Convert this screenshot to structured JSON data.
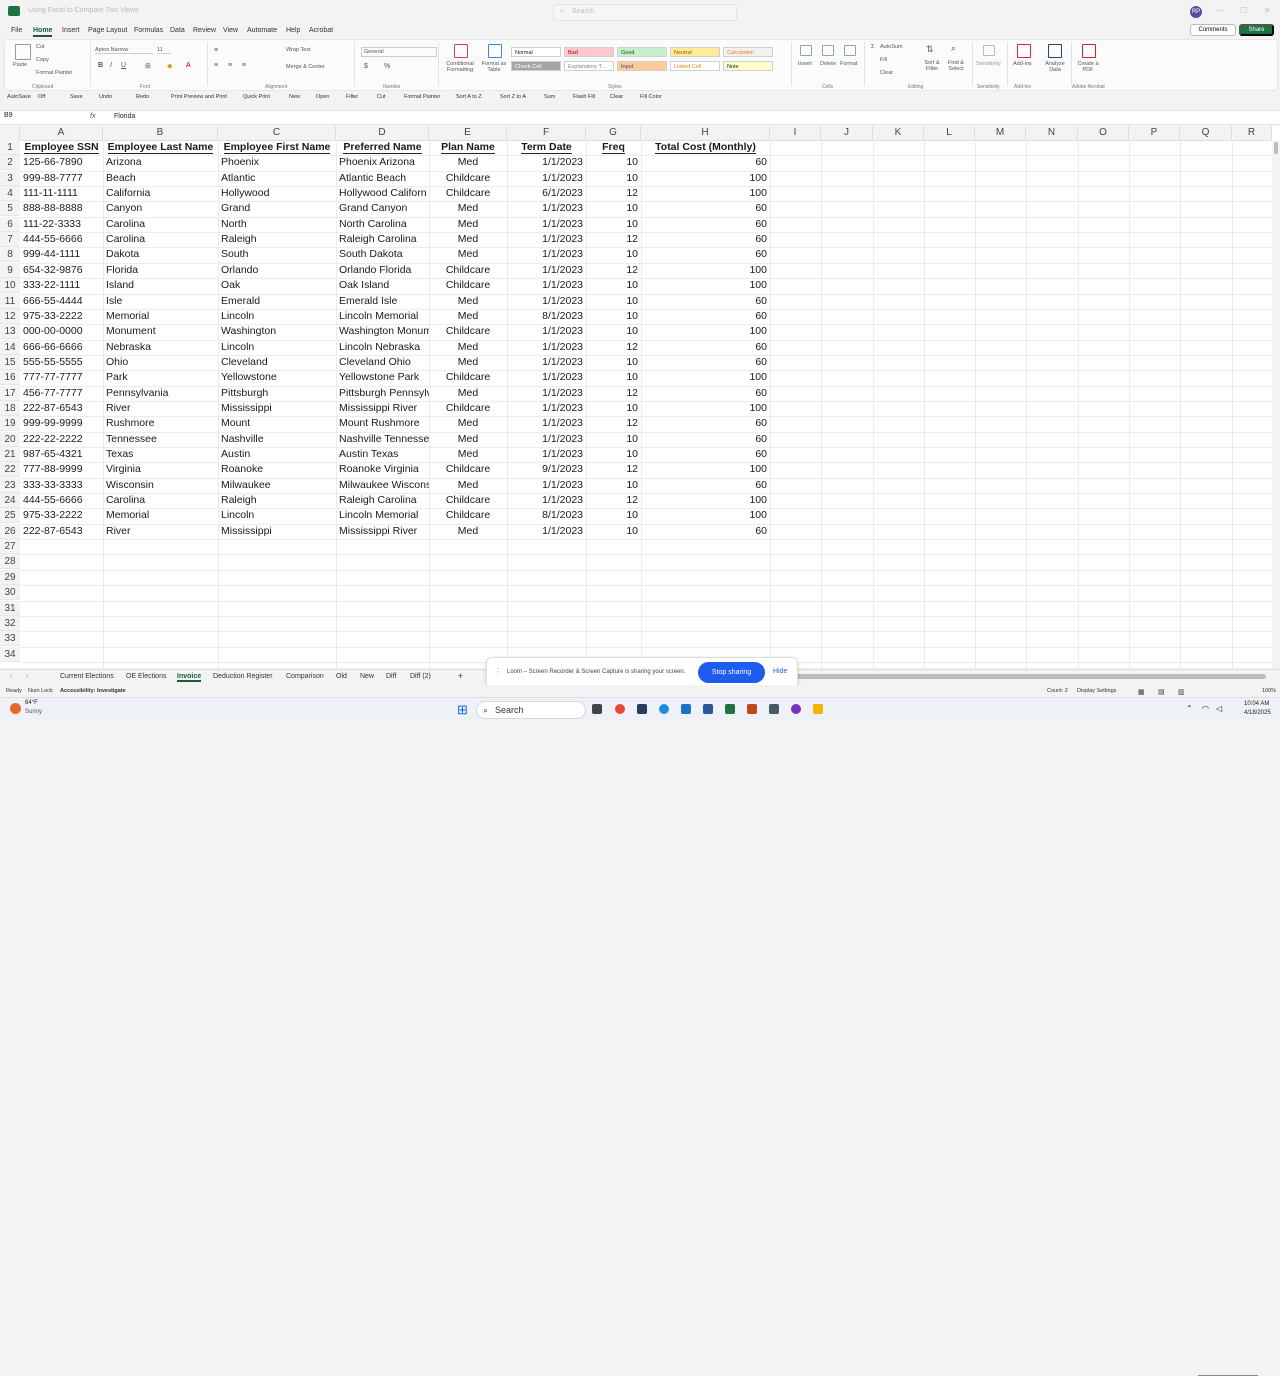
{
  "window": {
    "title": "Using Excel to Compare Two Views",
    "search_placeholder": "Search",
    "avatar_initials": "RP"
  },
  "menu": {
    "items": [
      "File",
      "Home",
      "Insert",
      "Page Layout",
      "Formulas",
      "Data",
      "Review",
      "View",
      "Automate",
      "Help",
      "Acrobat"
    ],
    "active": "Home",
    "comments": "Comments",
    "share": "Share"
  },
  "ribbon": {
    "clipboard": {
      "paste": "Paste",
      "cut": "Cut",
      "copy": "Copy",
      "format_painter": "Format Painter",
      "group": "Clipboard"
    },
    "font": {
      "name": "Aptos Narrow",
      "size": "11",
      "group": "Font"
    },
    "alignment": {
      "wrap": "Wrap Text",
      "merge": "Merge & Center",
      "group": "Alignment"
    },
    "number": {
      "format": "General",
      "group": "Number"
    },
    "styles": {
      "conditional": "Conditional Formatting",
      "format_table": "Format as Table",
      "group": "Styles",
      "boxes": [
        {
          "label": "Normal",
          "bg": "#ffffff",
          "fg": "#222222"
        },
        {
          "label": "Bad",
          "bg": "#ffc7ce",
          "fg": "#9c0006"
        },
        {
          "label": "Good",
          "bg": "#c6efce",
          "fg": "#006100"
        },
        {
          "label": "Neutral",
          "bg": "#ffeb9c",
          "fg": "#9c5700"
        },
        {
          "label": "Calculation",
          "bg": "#f2f2f2",
          "fg": "#fa7d00"
        },
        {
          "label": "Check Cell",
          "bg": "#a5a5a5",
          "fg": "#ffffff"
        },
        {
          "label": "Explanatory T...",
          "bg": "#ffffff",
          "fg": "#7f7f7f"
        },
        {
          "label": "Input",
          "bg": "#ffcc99",
          "fg": "#3f3f76"
        },
        {
          "label": "Linked Cell",
          "bg": "#ffffff",
          "fg": "#fa7d00"
        },
        {
          "label": "Note",
          "bg": "#ffffcc",
          "fg": "#222222"
        }
      ]
    },
    "cells": {
      "insert": "Insert",
      "delete": "Delete",
      "format": "Format",
      "group": "Cells"
    },
    "editing": {
      "autosum": "AutoSum",
      "fill": "Fill",
      "clear": "Clear",
      "sort": "Sort & Filter",
      "find": "Find & Select",
      "group": "Editing"
    },
    "sensitivity": {
      "label": "Sensitivity",
      "group": "Sensitivity"
    },
    "addins": {
      "addins": "Add-ins",
      "analyze": "Analyze Data",
      "group": "Add-ins"
    },
    "acrobat": {
      "create_pdf": "Create a PDF",
      "group": "Adobe Acrobat"
    }
  },
  "qat": [
    "AutoSave",
    "Off",
    "Save",
    "Undo",
    "Redo",
    "Print Preview and Print",
    "Quick Print",
    "New",
    "Open",
    "Filter",
    "Cut",
    "Format Painter",
    "Sort A to Z",
    "Sort Z to A",
    "Sum",
    "Flash Fill",
    "Clear",
    "Fill Color"
  ],
  "formula_bar": {
    "name_box": "B9",
    "fx": "fx",
    "value": "Florida"
  },
  "columns": [
    "A",
    "B",
    "C",
    "D",
    "E",
    "F",
    "G",
    "H",
    "I",
    "J",
    "K",
    "L",
    "M",
    "N",
    "O",
    "P",
    "Q",
    "R"
  ],
  "row_numbers": [
    "1",
    "2",
    "3",
    "4",
    "5",
    "6",
    "7",
    "8",
    "9",
    "10",
    "11",
    "12",
    "13",
    "14",
    "15",
    "16",
    "17",
    "18",
    "19",
    "20",
    "21",
    "22",
    "23",
    "24",
    "25",
    "26",
    "27",
    "28",
    "29",
    "30",
    "31",
    "32",
    "33",
    "34"
  ],
  "headers": [
    "Employee SSN",
    "Employee Last Name",
    "Employee First Name",
    "Preferred Name",
    "Plan Name",
    "Term Date",
    "Freq",
    "Total Cost (Monthly)"
  ],
  "rows": [
    [
      "125-66-7890",
      "Arizona",
      "Phoenix",
      "Phoenix Arizona",
      "Med",
      "1/1/2023",
      "10",
      "60"
    ],
    [
      "999-88-7777",
      "Beach",
      "Atlantic",
      "Atlantic Beach",
      "Childcare",
      "1/1/2023",
      "10",
      "100"
    ],
    [
      "111-11-1111",
      "California",
      "Hollywood",
      "Hollywood Californ",
      "Childcare",
      "6/1/2023",
      "12",
      "100"
    ],
    [
      "888-88-8888",
      "Canyon",
      "Grand",
      "Grand Canyon",
      "Med",
      "1/1/2023",
      "10",
      "60"
    ],
    [
      "111-22-3333",
      "Carolina",
      "North",
      "North Carolina",
      "Med",
      "1/1/2023",
      "10",
      "60"
    ],
    [
      "444-55-6666",
      "Carolina",
      "Raleigh",
      "Raleigh Carolina",
      "Med",
      "1/1/2023",
      "12",
      "60"
    ],
    [
      "999-44-1111",
      "Dakota",
      "South",
      "South Dakota",
      "Med",
      "1/1/2023",
      "10",
      "60"
    ],
    [
      "654-32-9876",
      "Florida",
      "Orlando",
      "Orlando Florida",
      "Childcare",
      "1/1/2023",
      "12",
      "100"
    ],
    [
      "333-22-1111",
      "Island",
      "Oak",
      "Oak Island",
      "Childcare",
      "1/1/2023",
      "10",
      "100"
    ],
    [
      "666-55-4444",
      "Isle",
      "Emerald",
      "Emerald Isle",
      "Med",
      "1/1/2023",
      "10",
      "60"
    ],
    [
      "975-33-2222",
      "Memorial",
      "Lincoln",
      "Lincoln Memorial",
      "Med",
      "8/1/2023",
      "10",
      "60"
    ],
    [
      "000-00-0000",
      "Monument",
      "Washington",
      "Washington Monum",
      "Childcare",
      "1/1/2023",
      "10",
      "100"
    ],
    [
      "666-66-6666",
      "Nebraska",
      "Lincoln",
      "Lincoln Nebraska",
      "Med",
      "1/1/2023",
      "12",
      "60"
    ],
    [
      "555-55-5555",
      "Ohio",
      "Cleveland",
      "Cleveland Ohio",
      "Med",
      "1/1/2023",
      "10",
      "60"
    ],
    [
      "777-77-7777",
      "Park",
      "Yellowstone",
      "Yellowstone Park",
      "Childcare",
      "1/1/2023",
      "10",
      "100"
    ],
    [
      "456-77-7777",
      "Pennsylvania",
      "Pittsburgh",
      "Pittsburgh Pennsylv",
      "Med",
      "1/1/2023",
      "12",
      "60"
    ],
    [
      "222-87-6543",
      "River",
      "Mississippi",
      "Mississippi River",
      "Childcare",
      "1/1/2023",
      "10",
      "100"
    ],
    [
      "999-99-9999",
      "Rushmore",
      "Mount",
      "Mount Rushmore",
      "Med",
      "1/1/2023",
      "12",
      "60"
    ],
    [
      "222-22-2222",
      "Tennessee",
      "Nashville",
      "Nashville Tennesse",
      "Med",
      "1/1/2023",
      "10",
      "60"
    ],
    [
      "987-65-4321",
      "Texas",
      "Austin",
      "Austin Texas",
      "Med",
      "1/1/2023",
      "10",
      "60"
    ],
    [
      "777-88-9999",
      "Virginia",
      "Roanoke",
      "Roanoke Virginia",
      "Childcare",
      "9/1/2023",
      "12",
      "100"
    ],
    [
      "333-33-3333",
      "Wisconsin",
      "Milwaukee",
      "Milwaukee Wiscons",
      "Med",
      "1/1/2023",
      "10",
      "60"
    ],
    [
      "444-55-6666",
      "Carolina",
      "Raleigh",
      "Raleigh Carolina",
      "Childcare",
      "1/1/2023",
      "12",
      "100"
    ],
    [
      "975-33-2222",
      "Memorial",
      "Lincoln",
      "Lincoln Memorial",
      "Childcare",
      "8/1/2023",
      "10",
      "100"
    ],
    [
      "222-87-6543",
      "River",
      "Mississippi",
      "Mississippi River",
      "Med",
      "1/1/2023",
      "10",
      "60"
    ]
  ],
  "sheet_tabs": [
    "Current Elections",
    "OE Elections",
    "Invoice",
    "Deduction Register",
    "Comparison",
    "Old",
    "New",
    "Diff",
    "Diff (2)"
  ],
  "active_tab": "Invoice",
  "add_sheet": "+",
  "loom": {
    "message": "Loom – Screen Recorder & Screen Capture is sharing your screen.",
    "stop": "Stop sharing",
    "hide": "Hide"
  },
  "status": {
    "ready": "Ready",
    "numlock": "Num Lock",
    "accessibility": "Accessibility: Investigate",
    "count": "Count: 2",
    "display": "Display Settings",
    "zoom": "100%"
  },
  "taskbar": {
    "weather_temp": "64°F",
    "weather_desc": "Sunny",
    "search": "Search",
    "time": "10:04 AM",
    "date": "4/18/2025"
  }
}
